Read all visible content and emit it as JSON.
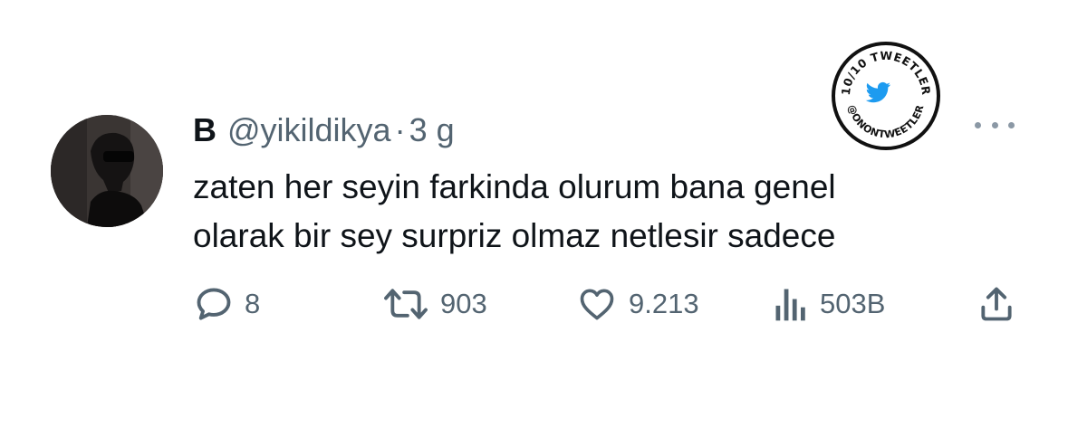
{
  "tweet": {
    "display_name": "B",
    "handle": "@yikildikya",
    "separator": "·",
    "time": "3 g",
    "text_lines": [
      "zaten her seyin farkinda olurum bana genel",
      "olarak bir sey surpriz olmaz netlesir sadece"
    ]
  },
  "actions": {
    "replies": "8",
    "retweets": "903",
    "likes": "9.213",
    "views": "503B"
  },
  "icons": {
    "reply": "reply-icon",
    "retweet": "retweet-icon",
    "like": "heart-icon",
    "views": "views-icon",
    "share": "share-icon",
    "more": "more-icon",
    "badge_bird": "twitter-bird-icon"
  },
  "badge": {
    "top_text": "10/10 TWEETLER",
    "bottom_text": "@ONONTWEETLER"
  },
  "colors": {
    "text_primary": "#0f1419",
    "text_secondary": "#536471",
    "twitter_blue": "#1d9bf0"
  }
}
